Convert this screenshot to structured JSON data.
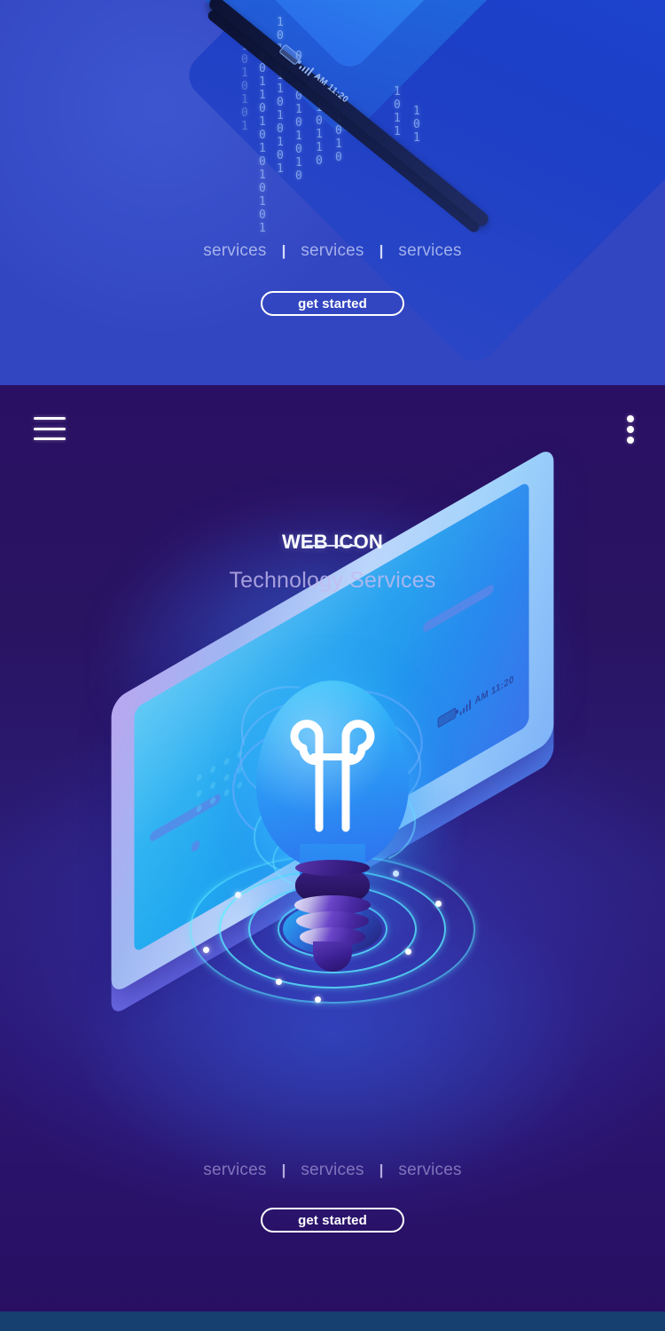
{
  "meta": {
    "theme": {
      "panel_top_bg": "#3346c2",
      "panel_main_bg_top": "#2a1063",
      "panel_main_bg_mid": "#2b1c77",
      "accent_cyan": "#5af0ff",
      "bulb_blue": "#2ea9f7",
      "screw_purple": "#3b1f92",
      "strip_navy": "#154070",
      "strip_indigo": "#25106b",
      "text_white": "#ffffff"
    }
  },
  "panel_top": {
    "device": {
      "status_clock": "AM 11:20",
      "battery_icon": "battery-icon",
      "signal_icon": "signal-bars-icon"
    },
    "binary_rain": [
      "0101101010101",
      "1010110101010",
      "0110101010011",
      "1011010101101",
      "0101011010100",
      "1100101101011",
      "0110100110101"
    ],
    "services": [
      {
        "label": "services"
      },
      {
        "label": "services"
      },
      {
        "label": "services"
      }
    ],
    "separator": "|",
    "cta_label": "get started"
  },
  "panel_main": {
    "nav": {
      "menu_icon": "hamburger-menu-icon",
      "overflow_icon": "kebab-menu-icon"
    },
    "title": "WEB ICON",
    "subtitle": "Technology Services",
    "illustration": {
      "name": "isometric-lightbulb-on-smartphone",
      "bulb": "lightbulb-icon",
      "filament": "filament-icon",
      "device": "smartphone-isometric",
      "device_status_clock": "AM 11:20",
      "ripple_rings": 4
    },
    "services": [
      {
        "label": "services"
      },
      {
        "label": "services"
      },
      {
        "label": "services"
      }
    ],
    "separator": "|",
    "cta_label": "get started"
  }
}
